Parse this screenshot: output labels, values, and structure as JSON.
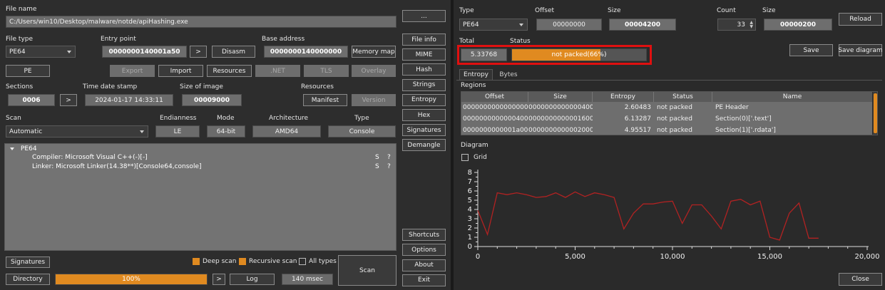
{
  "left": {
    "file_name_label": "File name",
    "file_name": "C:/Users/win10/Desktop/malware/notde/apiHashing.exe",
    "browse_label": "...",
    "file_type_label": "File type",
    "file_type": "PE64",
    "entry_point_label": "Entry point",
    "entry_point": "0000000140001a50",
    "entry_arrow": ">",
    "disasm_label": "Disasm",
    "base_address_label": "Base address",
    "base_address": "0000000140000000",
    "memory_map_label": "Memory map",
    "pe_label": "PE",
    "export_label": "Export",
    "import_label": "Import",
    "resources_btn_label": "Resources",
    "net_label": ".NET",
    "tls_label": "TLS",
    "overlay_label": "Overlay",
    "sections_label": "Sections",
    "sections_value": "0006",
    "sections_arrow": ">",
    "timestamp_label": "Time date stamp",
    "timestamp": "2024-01-17 14:33:11",
    "size_of_image_label": "Size of image",
    "size_of_image": "00009000",
    "resources_label": "Resources",
    "manifest_label": "Manifest",
    "version_label": "Version",
    "scan_label": "Scan",
    "scan_mode": "Automatic",
    "endianness_label": "Endianness",
    "endianness": "LE",
    "mode_label": "Mode",
    "mode": "64-bit",
    "architecture_label": "Architecture",
    "architecture": "AMD64",
    "type_label": "Type",
    "type": "Console",
    "tree_root": "PE64",
    "tree_items": [
      {
        "text": "Compiler: Microsoft Visual C++(-)[-]",
        "s": "S",
        "q": "?"
      },
      {
        "text": "Linker: Microsoft Linker(14.38**)[Console64,console]",
        "s": "S",
        "q": "?"
      }
    ],
    "signatures_label": "Signatures",
    "deep_scan_label": "Deep scan",
    "recursive_scan_label": "Recursive scan",
    "all_types_label": "All types",
    "directory_label": "Directory",
    "progress_text": "100%",
    "progress_fraction": 1.0,
    "progress_arrow": ">",
    "log_label": "Log",
    "time_label": "140 msec",
    "scan_btn_label": "Scan"
  },
  "side_buttons": [
    "File info",
    "MIME",
    "Hash",
    "Strings",
    "Entropy",
    "Hex",
    "Signatures",
    "Demangle"
  ],
  "side_bottom": [
    "Shortcuts",
    "Options",
    "About",
    "Exit"
  ],
  "right": {
    "type_label": "Type",
    "type": "PE64",
    "offset_label": "Offset",
    "offset": "00000000",
    "size_label": "Size",
    "size": "00004200",
    "count_label": "Count",
    "count": "33",
    "size2_label": "Size",
    "size2": "00000200",
    "reload_label": "Reload",
    "total_label": "Total",
    "total": "5.33768",
    "status_label": "Status",
    "status": "not packed(66%)",
    "status_fraction": 0.66,
    "save_label": "Save",
    "save_diagram_label": "Save diagram",
    "tabs": [
      "Entropy",
      "Bytes"
    ],
    "regions_label": "Regions",
    "columns": [
      "Offset",
      "Size",
      "Entropy",
      "Status",
      "Name"
    ],
    "rows": [
      [
        "0000000000000000",
        "0000000000000400",
        "2.60483",
        "not packed",
        "PE Header"
      ],
      [
        "0000000000000400",
        "0000000000001600",
        "6.13287",
        "not packed",
        "Section(0)['.text']"
      ],
      [
        "0000000000001a00",
        "0000000000002000",
        "4.95517",
        "not packed",
        "Section(1)['.rdata']"
      ]
    ],
    "diagram_label": "Diagram",
    "grid_label": "Grid",
    "close_label": "Close"
  },
  "chart_data": {
    "type": "line",
    "x_ticks": [
      "0",
      "5,000",
      "10,000",
      "15,000",
      "20,000"
    ],
    "y_ticks": [
      "0",
      "1",
      "2",
      "3",
      "4",
      "5",
      "6",
      "7",
      "8"
    ],
    "xlim": [
      0,
      20000
    ],
    "ylim": [
      0,
      8
    ],
    "grid": false,
    "series": [
      {
        "color": "#b22222",
        "points": [
          [
            0,
            3.9
          ],
          [
            500,
            1.3
          ],
          [
            1000,
            5.8
          ],
          [
            1500,
            5.6
          ],
          [
            2000,
            5.8
          ],
          [
            2500,
            5.6
          ],
          [
            3000,
            5.3
          ],
          [
            3500,
            5.4
          ],
          [
            4000,
            5.8
          ],
          [
            4500,
            5.3
          ],
          [
            5000,
            5.9
          ],
          [
            5500,
            5.4
          ],
          [
            6000,
            5.8
          ],
          [
            6500,
            5.6
          ],
          [
            7000,
            5.3
          ],
          [
            7500,
            1.9
          ],
          [
            8000,
            3.6
          ],
          [
            8500,
            4.6
          ],
          [
            9000,
            4.6
          ],
          [
            9500,
            4.8
          ],
          [
            10000,
            4.9
          ],
          [
            10500,
            2.5
          ],
          [
            11000,
            4.5
          ],
          [
            11500,
            4.5
          ],
          [
            12000,
            3.3
          ],
          [
            12500,
            1.9
          ],
          [
            13000,
            4.9
          ],
          [
            13500,
            5.1
          ],
          [
            14000,
            4.5
          ],
          [
            14500,
            4.9
          ],
          [
            15000,
            1.0
          ],
          [
            15500,
            0.7
          ],
          [
            16000,
            3.6
          ],
          [
            16500,
            4.7
          ],
          [
            17000,
            0.9
          ],
          [
            17500,
            0.9
          ]
        ]
      }
    ]
  }
}
